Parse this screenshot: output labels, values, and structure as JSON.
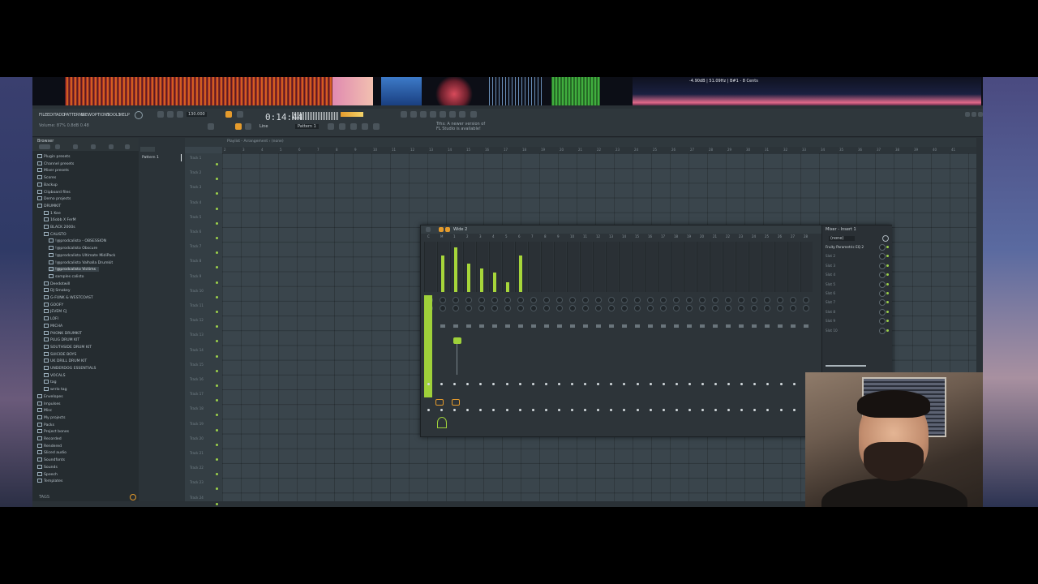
{
  "menu": {
    "items": [
      "FILE",
      "EDIT",
      "ADD",
      "PATTERNS",
      "VIEW",
      "OPTIONS",
      "TOOLS",
      "HELP"
    ]
  },
  "transport": {
    "tempo": "130.000",
    "time": "0:14:44",
    "pattern": "Pattern 1"
  },
  "hint": {
    "line1": "Volume: 87%  0.8dB  0.48",
    "notice1": "Trhs: A newer version of",
    "notice2": "FL Studio is available!"
  },
  "browser": {
    "title": "Browser",
    "search_placeholder": "",
    "items": [
      {
        "label": "Plugin presets",
        "level": 0
      },
      {
        "label": "Channel presets",
        "level": 0
      },
      {
        "label": "Mixer presets",
        "level": 0
      },
      {
        "label": "Scores",
        "level": 0
      },
      {
        "label": "Backup",
        "level": 0
      },
      {
        "label": "Clipboard files",
        "level": 0
      },
      {
        "label": "Demo projects",
        "level": 0
      },
      {
        "label": "DRUMKIT",
        "level": 0
      },
      {
        "label": "1 Kee",
        "level": 1
      },
      {
        "label": "16obb X FerM",
        "level": 1
      },
      {
        "label": "BLACK 2000s",
        "level": 1
      },
      {
        "label": "CALISTO",
        "level": 1
      },
      {
        "label": "!@prodcalisto - OBSESSION",
        "level": 2
      },
      {
        "label": "!@prodcalisto Obscure",
        "level": 2
      },
      {
        "label": "!@prodcalisto Ultimate MidiPack",
        "level": 2
      },
      {
        "label": "!@prodcalisto Valhalla Drumkit",
        "level": 2
      },
      {
        "label": "!@prodcalisto Victims",
        "level": 2
      },
      {
        "label": "samples calisto",
        "level": 2
      },
      {
        "label": "Deedotwill",
        "level": 1
      },
      {
        "label": "DJ Smokey",
        "level": 1
      },
      {
        "label": "G-FUNK & WESTCOAST",
        "level": 1
      },
      {
        "label": "GOOFY",
        "level": 1
      },
      {
        "label": "JEVEM CJ",
        "level": 1
      },
      {
        "label": "LOFI",
        "level": 1
      },
      {
        "label": "MICHA",
        "level": 1
      },
      {
        "label": "PHONK DRUMKIT",
        "level": 1
      },
      {
        "label": "PLUG DRUM KIT",
        "level": 1
      },
      {
        "label": "SOUTHSIDE DRUM KIT",
        "level": 1
      },
      {
        "label": "SUICIDE BOYS",
        "level": 1
      },
      {
        "label": "UK DRILL DRUM KIT",
        "level": 1
      },
      {
        "label": "UNDERDOG ESSENTIALS",
        "level": 1
      },
      {
        "label": "VOCALS",
        "level": 1
      },
      {
        "label": "tag",
        "level": 1
      },
      {
        "label": "wrrlo tag",
        "level": 1
      },
      {
        "label": "Envelopes",
        "level": 0
      },
      {
        "label": "Impulses",
        "level": 0
      },
      {
        "label": "Misc",
        "level": 0
      },
      {
        "label": "My projects",
        "level": 0
      },
      {
        "label": "Packs",
        "level": 0
      },
      {
        "label": "Project bones",
        "level": 0
      },
      {
        "label": "Recorded",
        "level": 0
      },
      {
        "label": "Rendered",
        "level": 0
      },
      {
        "label": "Sliced audio",
        "level": 0
      },
      {
        "label": "Soundfonts",
        "level": 0
      },
      {
        "label": "Sounds",
        "level": 0
      },
      {
        "label": "Speech",
        "level": 0
      },
      {
        "label": "Templates",
        "level": 0
      }
    ],
    "footer": "TAGS"
  },
  "picker": {
    "pattern": "Pattern 1"
  },
  "playlist": {
    "title": "Playlist - Arrangement › (none)",
    "ruler": [
      "2",
      "3",
      "4",
      "5",
      "6",
      "7",
      "8",
      "9",
      "10",
      "11",
      "12",
      "13",
      "14",
      "15",
      "16",
      "17",
      "18",
      "19",
      "20",
      "21",
      "22",
      "23",
      "24",
      "25",
      "26",
      "27",
      "28",
      "29",
      "30",
      "31",
      "32",
      "33",
      "34",
      "35",
      "36",
      "37",
      "38",
      "39",
      "40",
      "41"
    ],
    "tracks": [
      "Track 1",
      "Track 2",
      "Track 3",
      "Track 4",
      "Track 5",
      "Track 6",
      "Track 7",
      "Track 8",
      "Track 9",
      "Track 10",
      "Track 11",
      "Track 12",
      "Track 13",
      "Track 14",
      "Track 15",
      "Track 16",
      "Track 17",
      "Track 18",
      "Track 19",
      "Track 20",
      "Track 21",
      "Track 22",
      "Track 23",
      "Track 24"
    ]
  },
  "mixer": {
    "title": "Wide 2",
    "channels": [
      "C",
      "M",
      "1",
      "2",
      "3",
      "4",
      "5",
      "6",
      "7",
      "8",
      "9",
      "10",
      "11",
      "12",
      "13",
      "14",
      "15",
      "16",
      "17",
      "18",
      "19",
      "20",
      "21",
      "22",
      "23",
      "24",
      "25",
      "26",
      "27",
      "28"
    ],
    "levels": [
      0.0,
      0.78,
      0.95,
      0.6,
      0.5,
      0.42,
      0.2,
      0.78,
      0,
      0,
      0,
      0,
      0,
      0,
      0,
      0,
      0,
      0,
      0,
      0,
      0,
      0,
      0,
      0,
      0,
      0,
      0,
      0,
      0,
      0
    ],
    "fx_title": "Mixer - Insert 1",
    "fx_preset": "(none)",
    "fx_slots": [
      "Fruity Parametric EQ 2",
      "Slot 2",
      "Slot 3",
      "Slot 4",
      "Slot 5",
      "Slot 6",
      "Slot 7",
      "Slot 8",
      "Slot 9",
      "Slot 10"
    ],
    "colors": {
      "meter": "#a6d63a",
      "accent": "#e59b2c"
    }
  },
  "visualizer": {
    "readout": "-4.90dB | 51.09Hz | B#1 - 8 Cents"
  }
}
